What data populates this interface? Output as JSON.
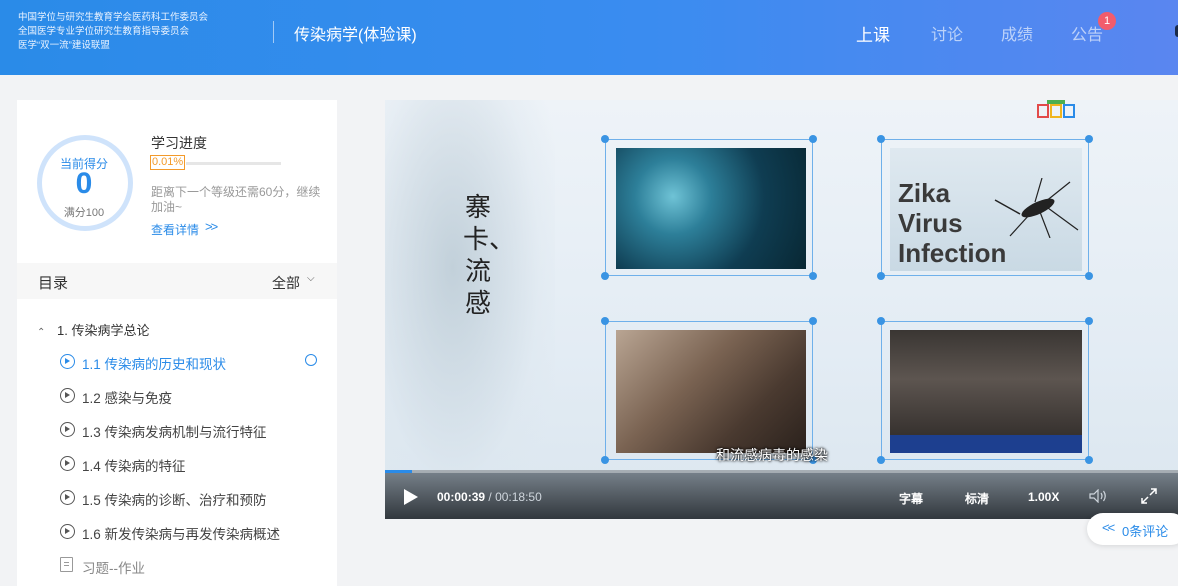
{
  "header": {
    "org_lines": [
      "中国学位与研究生教育学会医药科工作委员会",
      "全国医学专业学位研究生教育指导委员会",
      "医学“双一流”建设联盟"
    ],
    "course_title": "传染病学(体验课)",
    "nav": [
      "上课",
      "讨论",
      "成绩",
      "公告"
    ],
    "notice_badge": "1",
    "active_nav": "上课"
  },
  "score": {
    "label": "当前得分",
    "value": "0",
    "full": "满分100"
  },
  "progress": {
    "title": "学习进度",
    "percent_text": "0.01%",
    "fraction": 0.0001,
    "note": "距离下一个等级还需60分，继续加油~",
    "detail_link": "查看详情",
    "detail_arrows": ">>"
  },
  "toc": {
    "title": "目录",
    "filter": "全部",
    "chapter": "1. 传染病学总论",
    "lessons": [
      "1.1 传染病的历史和现状",
      "1.2 感染与免疫",
      "1.3 传染病发病机制与流行特征",
      "1.4 传染病的特征",
      "1.5 传染病的诊断、治疗和预防",
      "1.6 新发传染病与再发传染病概述"
    ],
    "active_index": 0,
    "homework": "习题--作业"
  },
  "video": {
    "slide_text": "寨卡、流感",
    "zika_caption": "Zika Virus Infection",
    "subtitle": "和流感病毒的感染",
    "current_time": "00:00:39",
    "total_time": "00:18:50",
    "played_fraction": 0.034,
    "controls": {
      "subtitles": "字幕",
      "quality": "标清",
      "speed": "1.00X"
    },
    "icons": [
      "play-icon",
      "volume-icon",
      "fullscreen-icon"
    ]
  },
  "comments": {
    "arrows": "<<",
    "label": "0条评论"
  },
  "colors": {
    "accent": "#2a8be8",
    "badge": "#f25c6c",
    "progress_text": "#f39a2a"
  }
}
